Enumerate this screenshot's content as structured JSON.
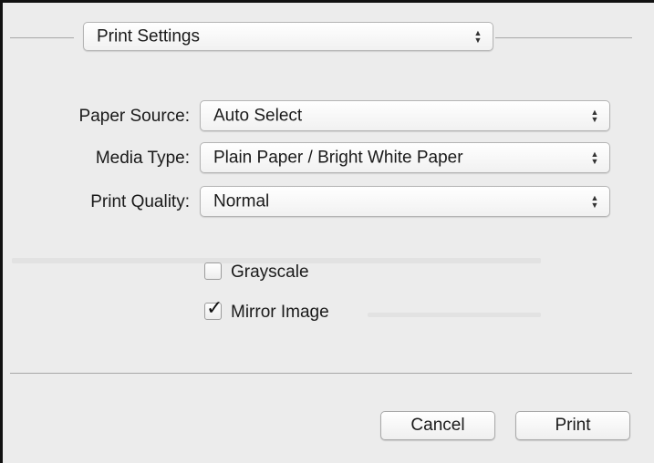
{
  "section_popup": {
    "value": "Print Settings"
  },
  "fields": [
    {
      "label": "Paper Source:",
      "value": "Auto Select"
    },
    {
      "label": "Media Type:",
      "value": "Plain Paper / Bright White Paper"
    },
    {
      "label": "Print Quality:",
      "value": "Normal"
    }
  ],
  "checkboxes": [
    {
      "label": "Grayscale",
      "checked": false
    },
    {
      "label": "Mirror Image",
      "checked": true
    }
  ],
  "buttons": {
    "cancel": "Cancel",
    "print": "Print"
  },
  "icons": {
    "popup_arrows": "up-down-chevron-icon",
    "check": "checkmark-icon"
  }
}
